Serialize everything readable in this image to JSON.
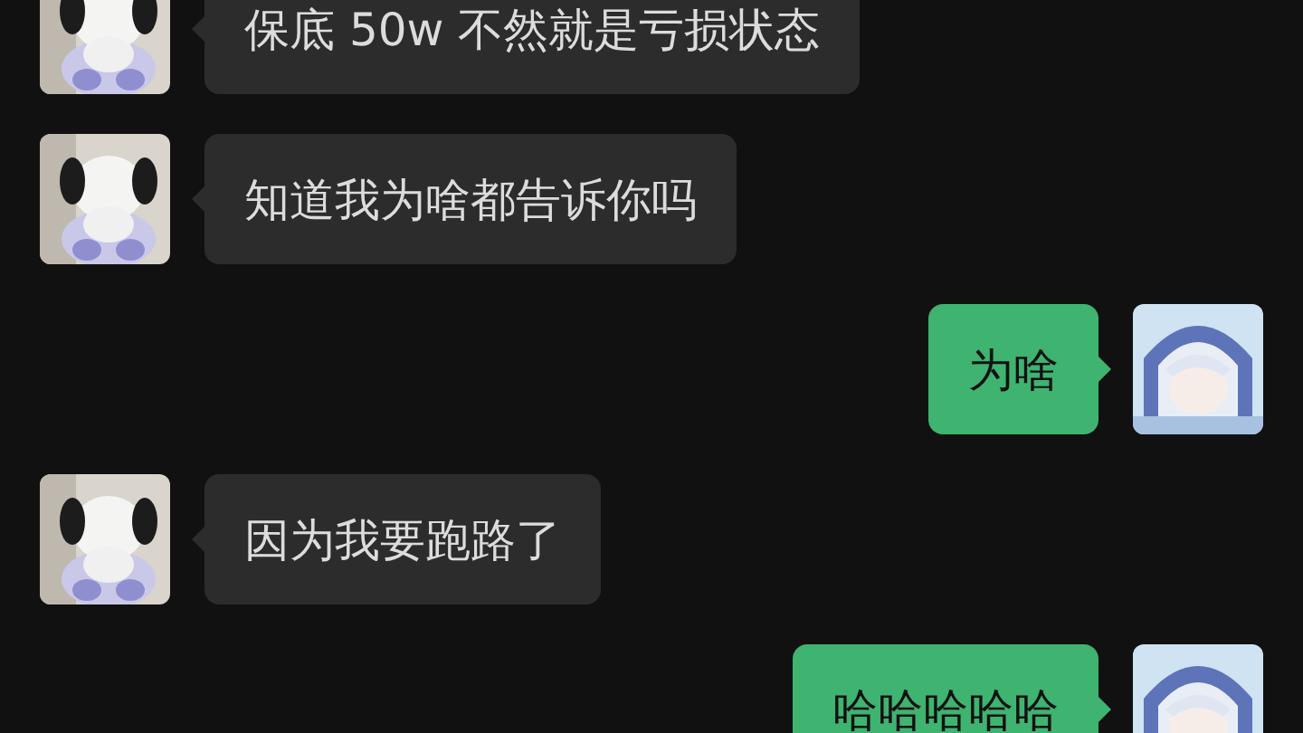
{
  "messages": [
    {
      "kind": "received",
      "text": "保底 50w 不然就是亏损状态"
    },
    {
      "kind": "received",
      "text": "知道我为啥都告诉你吗"
    },
    {
      "kind": "sent",
      "text": "为啥"
    },
    {
      "kind": "received",
      "text": "因为我要跑路了"
    },
    {
      "kind": "sent",
      "text": "哈哈哈哈哈"
    }
  ]
}
